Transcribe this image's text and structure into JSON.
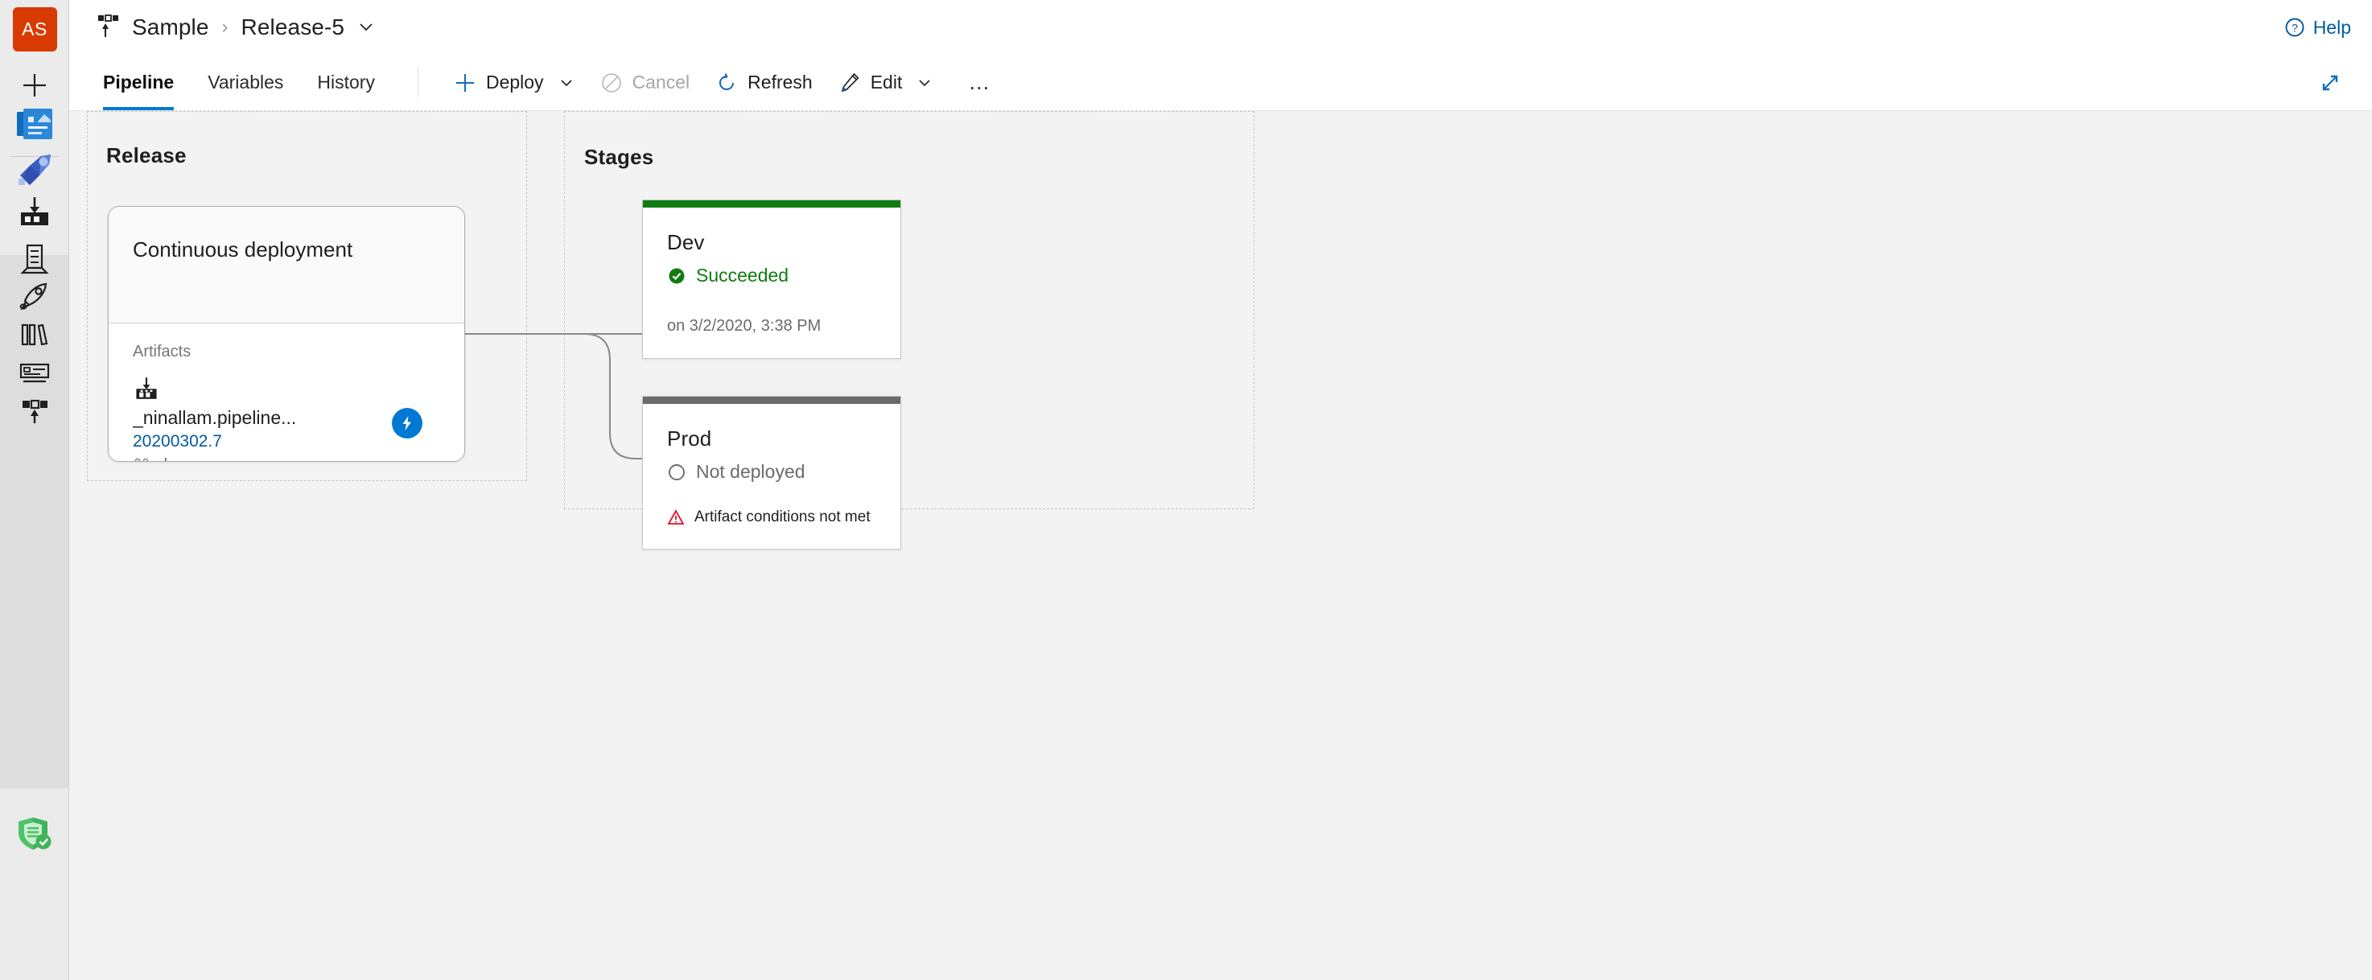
{
  "sidebar": {
    "avatar_initials": "AS",
    "items": [
      {
        "name": "new-item",
        "label": "New"
      },
      {
        "name": "azure-boards",
        "label": "Boards"
      },
      {
        "name": "azure-pipelines",
        "label": "Pipelines"
      },
      {
        "name": "artifact-download",
        "label": "Artifacts"
      },
      {
        "name": "release-definition",
        "label": "Releases"
      },
      {
        "name": "deploy-rocket",
        "label": "Deploy"
      },
      {
        "name": "library",
        "label": "Library"
      },
      {
        "name": "task-groups",
        "label": "Task groups"
      },
      {
        "name": "deployment-groups",
        "label": "Deployment groups"
      },
      {
        "name": "security-shield",
        "label": "Security"
      }
    ]
  },
  "header": {
    "project": "Sample",
    "separator": "›",
    "release": "Release-5",
    "help_label": "Help"
  },
  "toolbar": {
    "tabs": [
      {
        "label": "Pipeline",
        "active": true
      },
      {
        "label": "Variables",
        "active": false
      },
      {
        "label": "History",
        "active": false
      }
    ],
    "deploy_label": "Deploy",
    "cancel_label": "Cancel",
    "refresh_label": "Refresh",
    "edit_label": "Edit",
    "overflow_label": "…"
  },
  "canvas": {
    "release_group_title": "Release",
    "stages_group_title": "Stages",
    "release_card": {
      "title": "Continuous deployment",
      "artifacts_label": "Artifacts",
      "artifact_name": "_ninallam.pipeline...",
      "artifact_version": "20200302.7",
      "artifact_branch": "dev"
    },
    "stages": [
      {
        "name": "Dev",
        "status": "Succeeded",
        "status_color": "#107c10",
        "bar_color": "#107c10",
        "meta": "on 3/2/2020, 3:38 PM",
        "warning": ""
      },
      {
        "name": "Prod",
        "status": "Not deployed",
        "status_color": "#6b6b6b",
        "bar_color": "#6b6b6b",
        "meta": "",
        "warning": "Artifact conditions not met"
      }
    ]
  },
  "colors": {
    "accent": "#0078d4",
    "link": "#005a9e",
    "success": "#107c10",
    "error": "#e81123",
    "avatar": "#d83b01",
    "canvas_bg": "#f3f3f3"
  }
}
